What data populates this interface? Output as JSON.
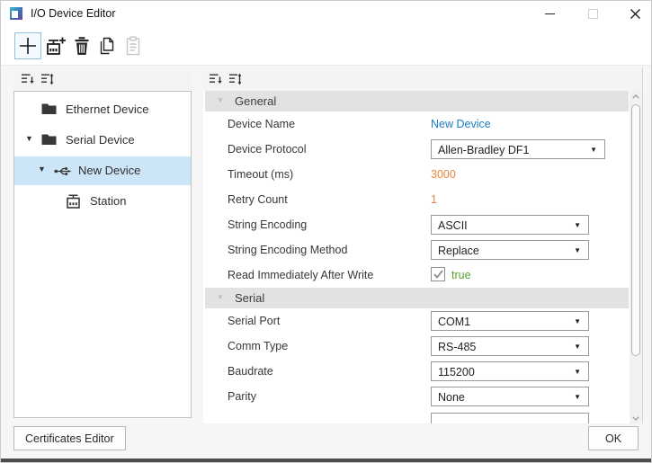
{
  "titlebar": {
    "title": "I/O Device Editor"
  },
  "toolbar": {
    "buttons": [
      {
        "name": "add-device",
        "icon": "plus-icon",
        "state": "highlighted"
      },
      {
        "name": "add-station",
        "icon": "station-add-icon",
        "state": "enabled"
      },
      {
        "name": "delete",
        "icon": "trash-icon",
        "state": "enabled"
      },
      {
        "name": "copy",
        "icon": "copy-icon",
        "state": "enabled"
      },
      {
        "name": "paste",
        "icon": "paste-icon",
        "state": "disabled"
      }
    ]
  },
  "tree": {
    "toolbar_icons": [
      "collapse-all-icon",
      "expand-all-icon"
    ],
    "items": [
      {
        "label": "Ethernet Device",
        "icon": "folder",
        "selected": false,
        "expanded": null
      },
      {
        "label": "Serial Device",
        "icon": "folder",
        "selected": false,
        "expanded": true
      },
      {
        "label": "New Device",
        "icon": "usb-device",
        "selected": true,
        "expanded": true
      },
      {
        "label": "Station",
        "icon": "station",
        "selected": false,
        "expanded": null
      }
    ]
  },
  "properties": {
    "toolbar_icons": [
      "collapse-all-icon",
      "expand-all-icon"
    ],
    "sections": [
      {
        "title": "General",
        "rows": [
          {
            "label": "Device Name",
            "type": "link",
            "value": "New Device"
          },
          {
            "label": "Device Protocol",
            "type": "dropdown",
            "value": "Allen-Bradley DF1"
          },
          {
            "label": "Timeout (ms)",
            "type": "number",
            "value": "3000"
          },
          {
            "label": "Retry Count",
            "type": "number",
            "value": "1"
          },
          {
            "label": "String Encoding",
            "type": "dropdown",
            "value": "ASCII"
          },
          {
            "label": "String Encoding Method",
            "type": "dropdown",
            "value": "Replace"
          },
          {
            "label": "Read Immediately After Write",
            "type": "checkbox",
            "value": "true",
            "checked": true
          }
        ]
      },
      {
        "title": "Serial",
        "rows": [
          {
            "label": "Serial Port",
            "type": "dropdown",
            "value": "COM1"
          },
          {
            "label": "Comm Type",
            "type": "dropdown",
            "value": "RS-485"
          },
          {
            "label": "Baudrate",
            "type": "dropdown",
            "value": "115200"
          },
          {
            "label": "Parity",
            "type": "dropdown",
            "value": "None"
          }
        ]
      }
    ]
  },
  "footer": {
    "certificates_button": "Certificates Editor",
    "ok_button": "OK"
  },
  "colors": {
    "link_value": "#1a7ec4",
    "number_value": "#e8833c",
    "boolean_true": "#55a02e",
    "tree_selection": "#cde6f7",
    "section_header_bg": "#e2e2e2",
    "toolbar_highlight_border": "#90c1e4",
    "bottom_edge": "#4c4c50"
  }
}
